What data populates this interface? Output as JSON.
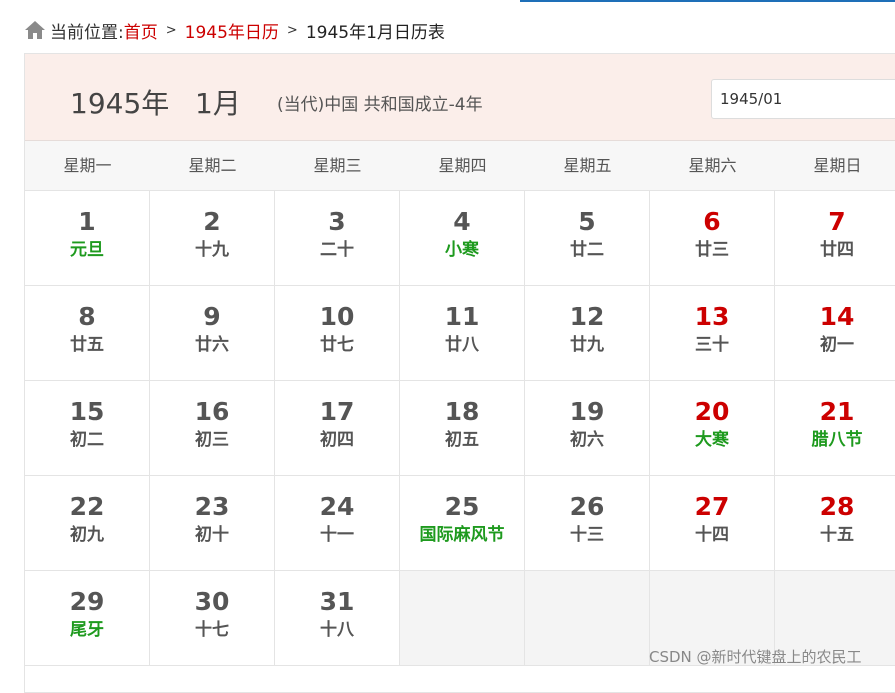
{
  "breadcrumb": {
    "prefix": "当前位置:",
    "home": "首页",
    "separator": ">",
    "year_calendar": "1945年日历",
    "current": "1945年1月日历表",
    "home_icon": "home-icon"
  },
  "header": {
    "year": "1945年",
    "month": "1月",
    "era": "(当代)中国 共和国成立-4年",
    "date_input_value": "1945/01"
  },
  "weekdays": [
    "星期一",
    "星期二",
    "星期三",
    "星期四",
    "星期五",
    "星期六",
    "星期日"
  ],
  "colors": {
    "festival": "#1e9a1e",
    "weekend": "#cc0000",
    "header_bg": "#fbeeea",
    "link": "#cc0000"
  },
  "weeks": [
    [
      {
        "day": "1",
        "sub": "元旦",
        "festival": true,
        "weekend": false
      },
      {
        "day": "2",
        "sub": "十九",
        "festival": false,
        "weekend": false
      },
      {
        "day": "3",
        "sub": "二十",
        "festival": false,
        "weekend": false
      },
      {
        "day": "4",
        "sub": "小寒",
        "festival": true,
        "weekend": false
      },
      {
        "day": "5",
        "sub": "廿二",
        "festival": false,
        "weekend": false
      },
      {
        "day": "6",
        "sub": "廿三",
        "festival": false,
        "weekend": true
      },
      {
        "day": "7",
        "sub": "廿四",
        "festival": false,
        "weekend": true
      }
    ],
    [
      {
        "day": "8",
        "sub": "廿五",
        "festival": false,
        "weekend": false
      },
      {
        "day": "9",
        "sub": "廿六",
        "festival": false,
        "weekend": false
      },
      {
        "day": "10",
        "sub": "廿七",
        "festival": false,
        "weekend": false
      },
      {
        "day": "11",
        "sub": "廿八",
        "festival": false,
        "weekend": false
      },
      {
        "day": "12",
        "sub": "廿九",
        "festival": false,
        "weekend": false
      },
      {
        "day": "13",
        "sub": "三十",
        "festival": false,
        "weekend": true
      },
      {
        "day": "14",
        "sub": "初一",
        "festival": false,
        "weekend": true
      }
    ],
    [
      {
        "day": "15",
        "sub": "初二",
        "festival": false,
        "weekend": false
      },
      {
        "day": "16",
        "sub": "初三",
        "festival": false,
        "weekend": false
      },
      {
        "day": "17",
        "sub": "初四",
        "festival": false,
        "weekend": false
      },
      {
        "day": "18",
        "sub": "初五",
        "festival": false,
        "weekend": false
      },
      {
        "day": "19",
        "sub": "初六",
        "festival": false,
        "weekend": false
      },
      {
        "day": "20",
        "sub": "大寒",
        "festival": true,
        "weekend": true
      },
      {
        "day": "21",
        "sub": "腊八节",
        "festival": true,
        "weekend": true
      }
    ],
    [
      {
        "day": "22",
        "sub": "初九",
        "festival": false,
        "weekend": false
      },
      {
        "day": "23",
        "sub": "初十",
        "festival": false,
        "weekend": false
      },
      {
        "day": "24",
        "sub": "十一",
        "festival": false,
        "weekend": false
      },
      {
        "day": "25",
        "sub": "国际麻风节",
        "festival": true,
        "weekend": false
      },
      {
        "day": "26",
        "sub": "十三",
        "festival": false,
        "weekend": false
      },
      {
        "day": "27",
        "sub": "十四",
        "festival": false,
        "weekend": true
      },
      {
        "day": "28",
        "sub": "十五",
        "festival": false,
        "weekend": true
      }
    ],
    [
      {
        "day": "29",
        "sub": "尾牙",
        "festival": true,
        "weekend": false
      },
      {
        "day": "30",
        "sub": "十七",
        "festival": false,
        "weekend": false
      },
      {
        "day": "31",
        "sub": "十八",
        "festival": false,
        "weekend": false
      },
      null,
      null,
      null,
      null
    ]
  ],
  "watermark": "CSDN @新时代键盘上的农民工"
}
